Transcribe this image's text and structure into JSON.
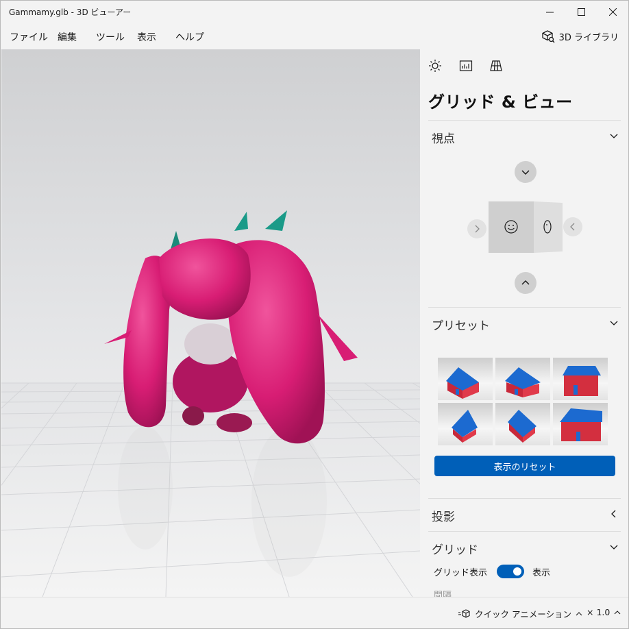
{
  "window": {
    "title": "Gammamy.glb - 3D ビューアー"
  },
  "menu": {
    "items": [
      "ファイル",
      "編集",
      "ツール",
      "表示",
      "ヘルプ"
    ],
    "library_label": "3D ライブラリ"
  },
  "panel": {
    "tabs": [
      "lighting-icon",
      "stats-icon",
      "grid-view-icon"
    ],
    "active_tab": 2,
    "title": "グリッド & ビュー",
    "sections": {
      "viewpoint": "視点",
      "presets": "プリセット",
      "projection": "投影",
      "grid": "グリッド"
    },
    "reset_label": "表示のリセット",
    "grid_display_label": "グリッド表示",
    "grid_toggle_state": "表示",
    "grid_toggle_on": true,
    "spacing_label": "間隔"
  },
  "statusbar": {
    "quick_animation": "クイック アニメーション",
    "speed": "× 1.0"
  },
  "colors": {
    "accent": "#005fb8",
    "model_pink": "#e01e78"
  }
}
